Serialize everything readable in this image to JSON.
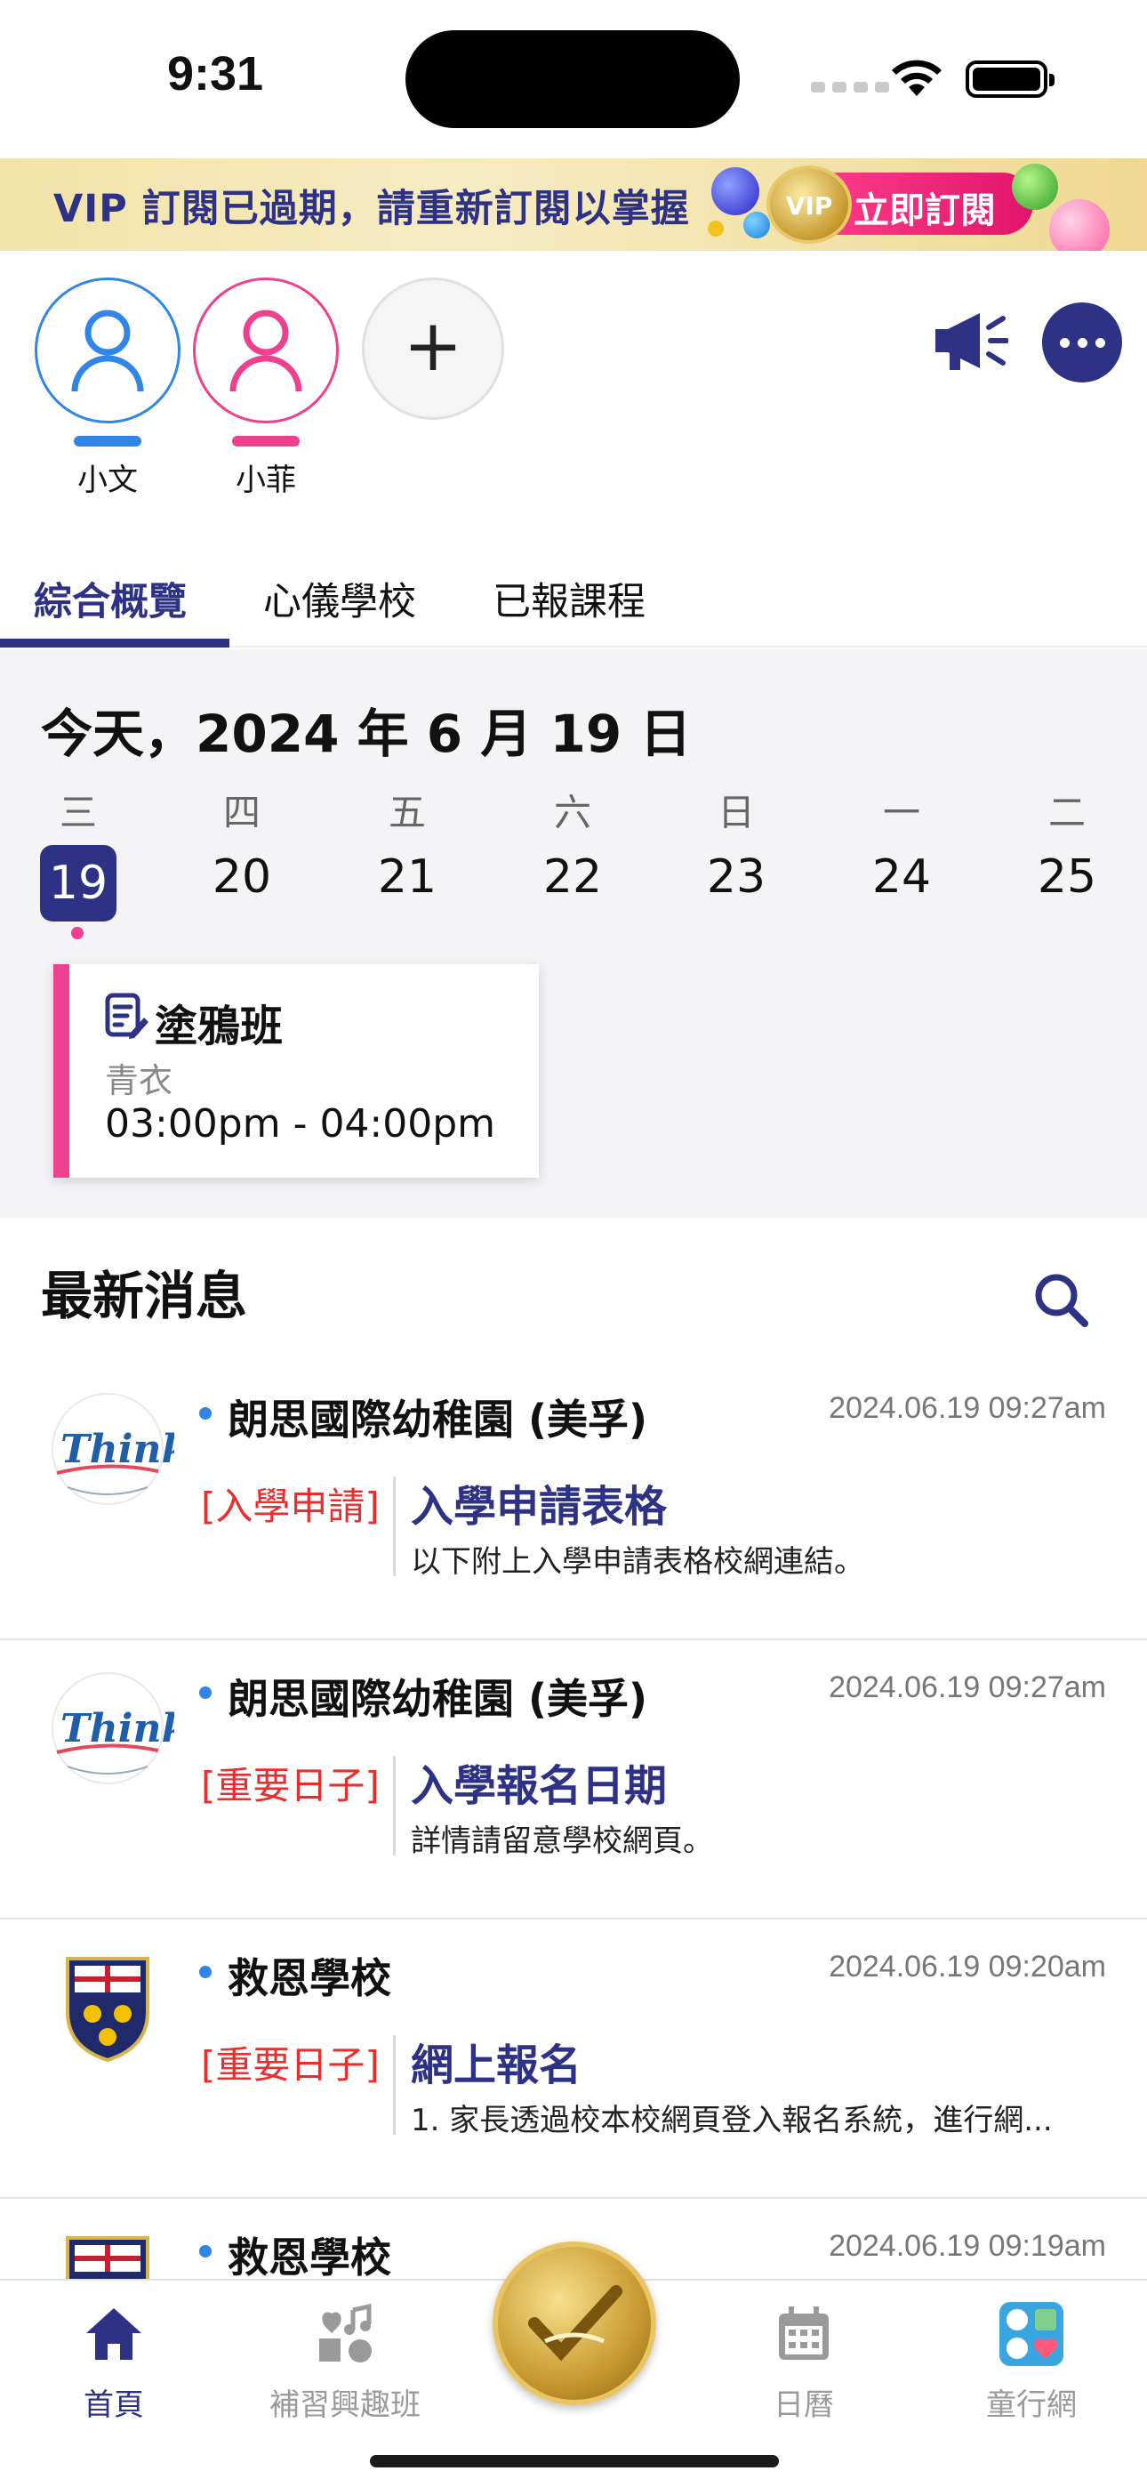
{
  "status_bar": {
    "time": "9:31"
  },
  "banner": {
    "text": "VIP 訂閱已過期，請重新訂閱以掌握",
    "badge": "VIP",
    "button_label": "立即訂閱"
  },
  "profiles": [
    {
      "name": "小文",
      "color": "#2f86e6"
    },
    {
      "name": "小菲",
      "color": "#ef3f8f"
    }
  ],
  "add_profile": "+",
  "tabs": [
    {
      "label": "綜合概覽",
      "active": true
    },
    {
      "label": "心儀學校",
      "active": false
    },
    {
      "label": "已報課程",
      "active": false
    }
  ],
  "calendar": {
    "today_label": "今天，2024 年 6 月 19 日",
    "weekdays": [
      "三",
      "四",
      "五",
      "六",
      "日",
      "一",
      "二"
    ],
    "days": [
      "19",
      "20",
      "21",
      "22",
      "23",
      "24",
      "25"
    ],
    "event": {
      "title": "塗鴉班",
      "place": "青衣",
      "time": "03:00pm - 04:00pm"
    }
  },
  "news": {
    "header": "最新消息",
    "items": [
      {
        "school": "朗思國際幼稚園 (美孚)",
        "time": "2024.06.19 09:27am",
        "tag": "[入學申請]",
        "title": "入學申請表格",
        "desc": "以下附上入學申請表格校網連結。",
        "logo": "think-logo"
      },
      {
        "school": "朗思國際幼稚園 (美孚)",
        "time": "2024.06.19 09:27am",
        "tag": "[重要日子]",
        "title": "入學報名日期",
        "desc": "詳情請留意學校網頁。",
        "logo": "think-logo"
      },
      {
        "school": "救恩學校",
        "time": "2024.06.19 09:20am",
        "tag": "[重要日子]",
        "title": "網上報名",
        "desc": "1. 家長透過校本校網頁登入報名系統，進行網...",
        "logo": "ksy-crest-logo"
      },
      {
        "school": "救恩學校",
        "time": "2024.06.19 09:19am",
        "tag": "",
        "title": "",
        "desc": "",
        "logo": "ksy-crest-logo"
      }
    ]
  },
  "tabbar": {
    "items": [
      {
        "label": "首頁",
        "icon": "home-icon",
        "active": true
      },
      {
        "label": "補習興趣班",
        "icon": "hobby-icon",
        "active": false
      },
      {
        "label": "日曆",
        "icon": "calendar-icon",
        "active": false
      },
      {
        "label": "童行網",
        "icon": "community-icon",
        "active": false
      }
    ]
  },
  "colors": {
    "brand": "#2e3284",
    "pink": "#ef3f8f",
    "blue": "#2f86e6",
    "tag_red": "#ea2d2d"
  }
}
